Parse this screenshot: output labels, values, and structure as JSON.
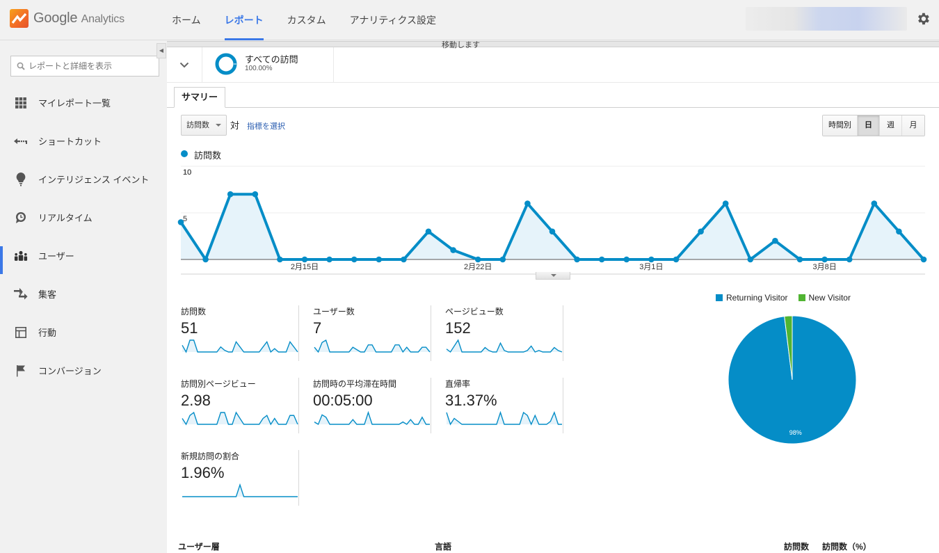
{
  "header": {
    "logo_text": "Google",
    "logo_sub": "Analytics",
    "nav": [
      {
        "label": "ホーム",
        "active": false
      },
      {
        "label": "レポート",
        "active": true
      },
      {
        "label": "カスタム",
        "active": false
      },
      {
        "label": "アナリティクス設定",
        "active": false
      }
    ],
    "settings_icon": "gear-icon"
  },
  "sidebar": {
    "search_placeholder": "レポートと詳細を表示",
    "items": [
      {
        "label": "マイレポート一覧",
        "icon": "grid-icon",
        "active": false
      },
      {
        "label": "ショートカット",
        "icon": "shortcut-arrow-icon",
        "active": false
      },
      {
        "label": "インテリジェンス イベント",
        "icon": "lightbulb-icon",
        "active": false
      },
      {
        "label": "リアルタイム",
        "icon": "clock-bubble-icon",
        "active": false
      },
      {
        "label": "ユーザー",
        "icon": "users-icon",
        "active": true
      },
      {
        "label": "集客",
        "icon": "acquisition-arrows-icon",
        "active": false
      },
      {
        "label": "行動",
        "icon": "layout-icon",
        "active": false
      },
      {
        "label": "コンバージョン",
        "icon": "flag-icon",
        "active": false
      }
    ]
  },
  "segment": {
    "name": "すべての訪問",
    "percent": "100.00%",
    "ghost_text": "移動します"
  },
  "tabs": [
    {
      "label": "サマリー",
      "active": true
    }
  ],
  "controls": {
    "metric_select": "訪問数",
    "vs_label": "対",
    "pick_metric": "指標を選択",
    "periods": [
      {
        "label": "時間別",
        "active": false
      },
      {
        "label": "日",
        "active": true
      },
      {
        "label": "週",
        "active": false
      },
      {
        "label": "月",
        "active": false
      }
    ]
  },
  "chart_data": [
    {
      "type": "area",
      "title": "",
      "legend": [
        "訪問数"
      ],
      "series": [
        {
          "name": "訪問数",
          "color": "#058dc7",
          "values": [
            4,
            0,
            7,
            7,
            0,
            0,
            0,
            0,
            0,
            0,
            3,
            1,
            0,
            0,
            6,
            3,
            0,
            0,
            0,
            0,
            0,
            3,
            6,
            0,
            2,
            0,
            0,
            0,
            6,
            3,
            0
          ]
        }
      ],
      "x_tick_labels": [
        {
          "index": 5,
          "label": "2月15日"
        },
        {
          "index": 12,
          "label": "2月22日"
        },
        {
          "index": 19,
          "label": "3月1日"
        },
        {
          "index": 26,
          "label": "3月8日"
        }
      ],
      "y_ticks": [
        5,
        10
      ],
      "ylim": [
        0,
        10
      ],
      "grid": true
    },
    {
      "type": "pie",
      "legend_position": "top",
      "slices": [
        {
          "label": "Returning Visitor",
          "value": 98.04,
          "color": "#058dc7",
          "display": "98%"
        },
        {
          "label": "New Visitor",
          "value": 1.96,
          "color": "#50b432",
          "display": ""
        }
      ]
    }
  ],
  "metrics": [
    {
      "name": "訪問数",
      "value": "51",
      "spark": [
        4,
        0,
        7,
        7,
        0,
        0,
        0,
        0,
        0,
        0,
        3,
        1,
        0,
        0,
        6,
        3,
        0,
        0,
        0,
        0,
        0,
        3,
        6,
        0,
        2,
        0,
        0,
        0,
        6,
        3,
        0
      ]
    },
    {
      "name": "ユーザー数",
      "value": "7",
      "spark": [
        2,
        0,
        4,
        5,
        0,
        0,
        0,
        0,
        0,
        0,
        2,
        1,
        0,
        0,
        3,
        3,
        0,
        0,
        0,
        0,
        0,
        3,
        3,
        0,
        2,
        0,
        0,
        0,
        2,
        2,
        0
      ]
    },
    {
      "name": "ページビュー数",
      "value": "152",
      "spark": [
        2,
        0,
        4,
        8,
        0,
        0,
        0,
        0,
        0,
        0,
        3,
        1,
        0,
        0,
        6,
        1,
        0,
        0,
        0,
        0,
        0,
        1,
        4,
        0,
        1,
        0,
        0,
        0,
        3,
        1,
        0
      ]
    },
    {
      "name": "訪問別ページビュー",
      "value": "2.98",
      "spark": [
        2,
        0,
        3,
        4,
        0,
        0,
        0,
        0,
        0,
        0,
        4,
        4,
        0,
        0,
        4,
        2,
        0,
        0,
        0,
        0,
        0,
        2,
        3,
        0,
        2,
        0,
        0,
        0,
        3,
        3,
        0
      ]
    },
    {
      "name": "訪問時の平均滞在時間",
      "value": "00:05:00",
      "spark": [
        1,
        0,
        4,
        3,
        0,
        0,
        0,
        0,
        0,
        0,
        2,
        0,
        0,
        0,
        5,
        0,
        0,
        0,
        0,
        0,
        0,
        0,
        0,
        1,
        0,
        2,
        0,
        0,
        3,
        0,
        0
      ]
    },
    {
      "name": "直帰率",
      "value": "31.37%",
      "spark": [
        4,
        0,
        2,
        1,
        0,
        0,
        0,
        0,
        0,
        0,
        0,
        0,
        0,
        0,
        4,
        0,
        0,
        0,
        0,
        0,
        4,
        3,
        0,
        3,
        0,
        0,
        0,
        1,
        4,
        0,
        0
      ]
    },
    {
      "name": "新規訪問の割合",
      "value": "1.96%",
      "spark": [
        0,
        0,
        0,
        0,
        0,
        0,
        0,
        0,
        0,
        0,
        0,
        0,
        0,
        0,
        0,
        4,
        0,
        0,
        0,
        0,
        0,
        0,
        0,
        0,
        0,
        0,
        0,
        0,
        0,
        0,
        0
      ]
    }
  ],
  "table": {
    "headers": [
      "ユーザー層",
      "言語",
      "訪問数",
      "訪問数（%）"
    ]
  }
}
